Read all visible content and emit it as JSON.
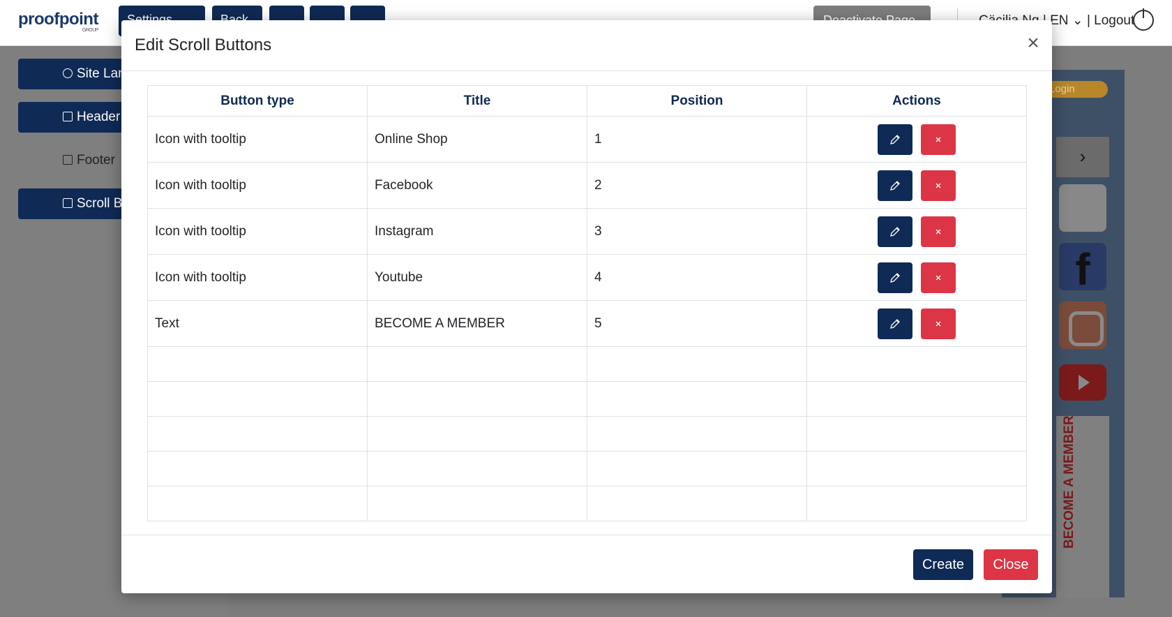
{
  "app": {
    "logo": "proofpoint",
    "logo_sub": "GROUP",
    "toolbar": [
      "Settings",
      "Back"
    ],
    "deactivate_label": "Deactivate Page",
    "user_line": "Cäcilia Ng | EN  ⌄ | Logout"
  },
  "sidebar": {
    "items": [
      {
        "label": "Site Language"
      },
      {
        "label": "Header Menu"
      },
      {
        "label": "Footer"
      },
      {
        "label": "Scroll Buttons"
      }
    ]
  },
  "preview": {
    "login_label": "Login",
    "member_label": "BECOME A MEMBER"
  },
  "modal": {
    "title": "Edit Scroll Buttons",
    "close_icon": "×",
    "columns": [
      "Button type",
      "Title",
      "Position",
      "Actions"
    ],
    "rows": [
      {
        "type": "Icon with tooltip",
        "title": "Online Shop",
        "position": "1"
      },
      {
        "type": "Icon with tooltip",
        "title": "Facebook",
        "position": "2"
      },
      {
        "type": "Icon with tooltip",
        "title": "Instagram",
        "position": "3"
      },
      {
        "type": "Icon with tooltip",
        "title": "Youtube",
        "position": "4"
      },
      {
        "type": "Text",
        "title": "BECOME A MEMBER",
        "position": "5"
      }
    ],
    "create_label": "Create",
    "close_label": "Close"
  },
  "colors": {
    "primary": "#0f2a55",
    "danger": "#dc3545"
  }
}
